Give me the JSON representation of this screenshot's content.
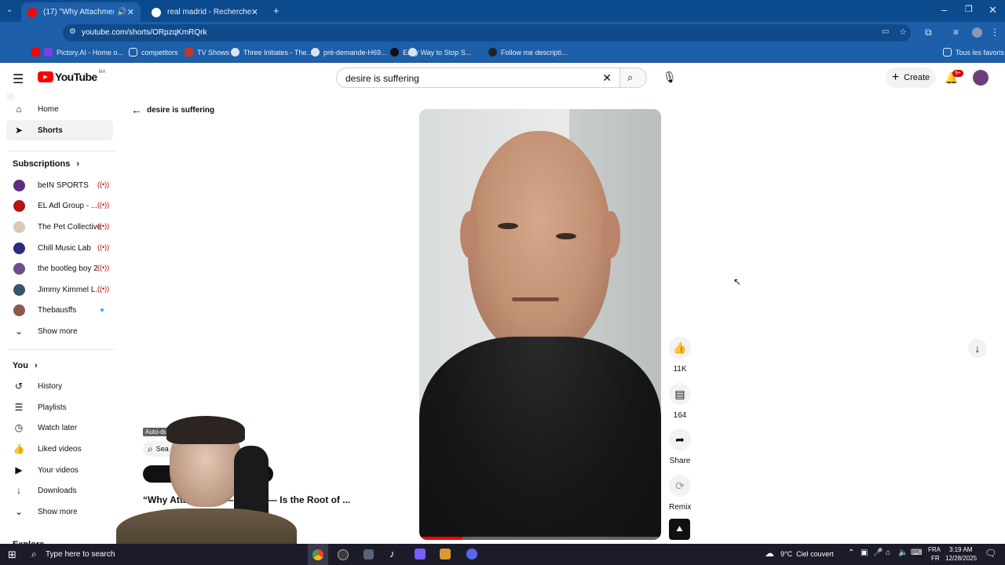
{
  "browser": {
    "tabs": [
      {
        "title": "(17) \"Why Attachment — N",
        "active": true
      },
      {
        "title": "real madrid - Recherche Googl",
        "active": false
      }
    ],
    "url": "youtube.com/shorts/ORpzqKmRQrk",
    "bookmarks": [
      "Pictory.AI - Home o...",
      "competitors",
      "TV Shows",
      "Three Initiates - The...",
      "pré-demande-H69...",
      "Easy Way to Stop S...",
      "Follow me descripti...",
      "Tous les favoris"
    ]
  },
  "youtube": {
    "logo_text": "YouTube",
    "country": "MA",
    "search_value": "desire is suffering",
    "create_label": "Create",
    "notif_count": "9+",
    "back_query": "desire is suffering",
    "sidebar": {
      "home": "Home",
      "shorts": "Shorts",
      "subscriptions": "Subscriptions",
      "channels": [
        "beIN SPORTS",
        "EL Adl Group - ...",
        "The Pet Collective",
        "Chill Music Lab",
        "the bootleg boy 2",
        "Jimmy Kimmel L...",
        "Thebausffs"
      ],
      "show_more": "Show more",
      "you": "You",
      "you_items": [
        "History",
        "Playlists",
        "Watch later",
        "Liked videos",
        "Your videos",
        "Downloads"
      ],
      "show_more2": "Show more",
      "explore": "Explore"
    },
    "actions": {
      "likes": "11K",
      "comments": "164",
      "share": "Share",
      "remix": "Remix"
    },
    "result": {
      "badge": "Auto-dubbed",
      "title": "“Why Attachment — Desire — Is the Root of ...",
      "search_hint": "Sea",
      "channel_fragment": "sic"
    }
  },
  "taskbar": {
    "search_placeholder": "Type here to search",
    "weather": "9°C  Ciel couvert",
    "lang": "FRA",
    "lang2": "FR",
    "time": "3:19 AM",
    "date": "12/28/2025"
  },
  "colors": {
    "chrome": "#1d5fa8",
    "yt_red": "#ff0000"
  }
}
